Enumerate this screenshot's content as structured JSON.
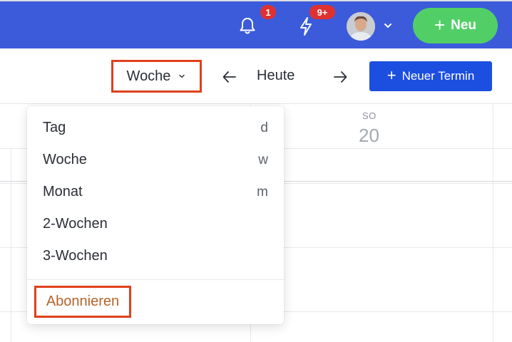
{
  "topbar": {
    "bg_color": "#3b5bdb",
    "notifications": {
      "icon": "bell-icon",
      "badge": "1"
    },
    "activity": {
      "icon": "bolt-icon",
      "badge": "9+"
    },
    "user_menu": {
      "icon": "chevron-down-icon"
    },
    "new_button": {
      "label": "Neu",
      "icon": "plus-icon",
      "color": "#51cf66"
    }
  },
  "toolbar": {
    "view_select": "Woche",
    "prev_icon": "arrow-left-icon",
    "today_label": "Heute",
    "next_icon": "arrow-right-icon",
    "new_event": {
      "label": "Neuer Termin",
      "color": "#1c4ee0"
    }
  },
  "calendar": {
    "visible_day": {
      "weekday": "SO",
      "date": "20"
    }
  },
  "view_menu": {
    "items": [
      {
        "label": "Tag",
        "shortcut": "d"
      },
      {
        "label": "Woche",
        "shortcut": "w"
      },
      {
        "label": "Monat",
        "shortcut": "m"
      },
      {
        "label": "2-Wochen",
        "shortcut": ""
      },
      {
        "label": "3-Wochen",
        "shortcut": ""
      }
    ],
    "subscribe": {
      "label": "Abonnieren",
      "color": "#b5632a"
    }
  },
  "highlight_color": "#e0401c"
}
